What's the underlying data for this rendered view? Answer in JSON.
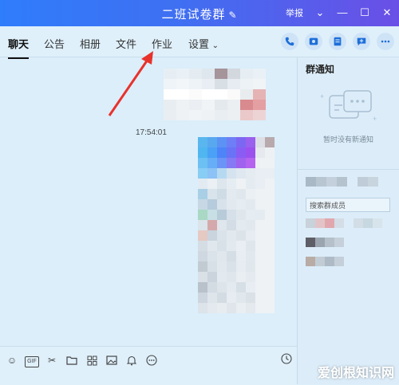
{
  "window": {
    "title": "二班试卷群",
    "report_label": "举报"
  },
  "tabs": [
    {
      "label": "聊天"
    },
    {
      "label": "公告"
    },
    {
      "label": "相册"
    },
    {
      "label": "文件"
    },
    {
      "label": "作业"
    },
    {
      "label": "设置"
    }
  ],
  "chat": {
    "timestamp": "17:54:01"
  },
  "side": {
    "title": "群通知",
    "empty_note": "暂时没有新通知",
    "search_placeholder": "搜索群成员"
  },
  "watermark": "爱创根知识网",
  "colors": {
    "titlebar_start": "#2f7dfb",
    "titlebar_end": "#6a4fe6",
    "arrow": "#e8322c"
  }
}
